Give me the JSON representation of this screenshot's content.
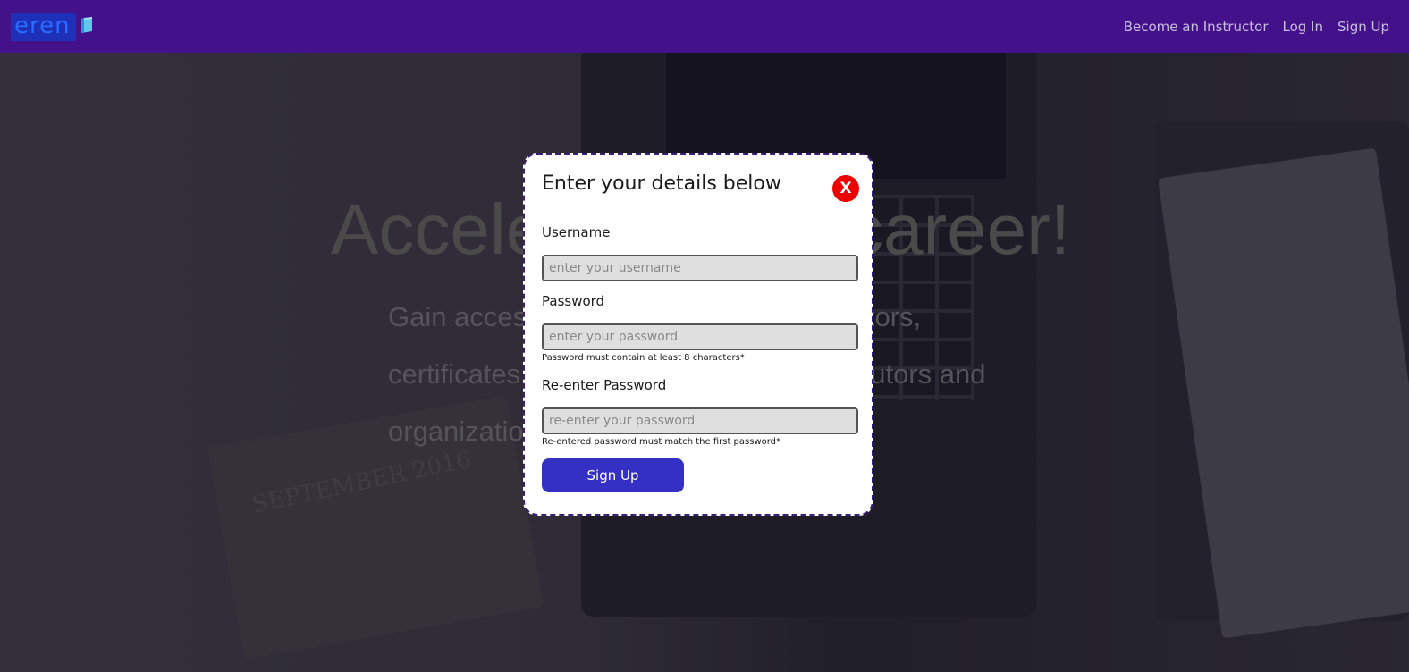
{
  "navbar": {
    "logo_text": "eren",
    "links": [
      "Become an Instructor",
      "Log In",
      "Sign Up"
    ]
  },
  "hero": {
    "title": "Accelerate your career!",
    "subtitle": "Gain access to top-tier courses, instructors, certificates and more from world-class tutors and organizations."
  },
  "modal": {
    "title": "Enter your details below",
    "close_label": "X",
    "username": {
      "label": "Username",
      "placeholder": "enter your username",
      "value": ""
    },
    "password": {
      "label": "Password",
      "placeholder": "enter your password",
      "value": "",
      "hint": "Password must contain at least 8 characters*"
    },
    "reenter_password": {
      "label": "Re-enter Password",
      "placeholder": "re-enter your password",
      "value": "",
      "hint": "Re-entered password must match the first password*"
    },
    "submit_label": "Sign Up"
  },
  "background": {
    "notebook_text": "SEPTEMBER 2016"
  },
  "colors": {
    "navbar": "#43118a",
    "submit_button": "#3530c4",
    "close_button": "#ee0000",
    "modal_border": "#3b1e7a"
  }
}
